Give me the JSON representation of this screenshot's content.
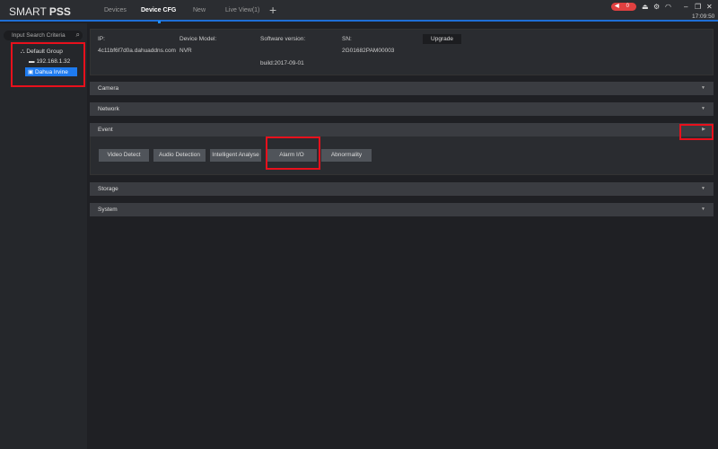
{
  "app": {
    "logo_light": "SMART ",
    "logo_bold": "PSS",
    "time": "17:09:50",
    "alarm_count": "0"
  },
  "tabs": [
    {
      "label": "Devices"
    },
    {
      "label": "Device CFG",
      "active": true
    },
    {
      "label": "New"
    },
    {
      "label": "Live View(1)"
    }
  ],
  "sidebar": {
    "search_placeholder": "Input Search Criteria",
    "group": "Default Group",
    "devices": [
      {
        "label": "192.168.1.32"
      },
      {
        "label": "Dahua Irvine",
        "selected": true
      }
    ]
  },
  "info": {
    "ip_label": "IP:",
    "ip": "4c11bf6f7d0a.dahuaddns.com",
    "model_label": "Device Model:",
    "model": "NVR",
    "sw_label": "Software version:",
    "sw": "build:2017-09-01",
    "sn_label": "SN:",
    "sn": "2G01682PAM00003",
    "upgrade": "Upgrade"
  },
  "sections": [
    "Camera",
    "Network",
    "Event",
    "Storage",
    "System"
  ],
  "event_buttons": [
    "Video Detect",
    "Audio Detection",
    "Intelligent Analyse",
    "Alarm I/O",
    "Abnormality"
  ],
  "colors": {
    "accent": "#1e7bf0",
    "alarm": "#e04040",
    "annotation": "#e8101c"
  }
}
